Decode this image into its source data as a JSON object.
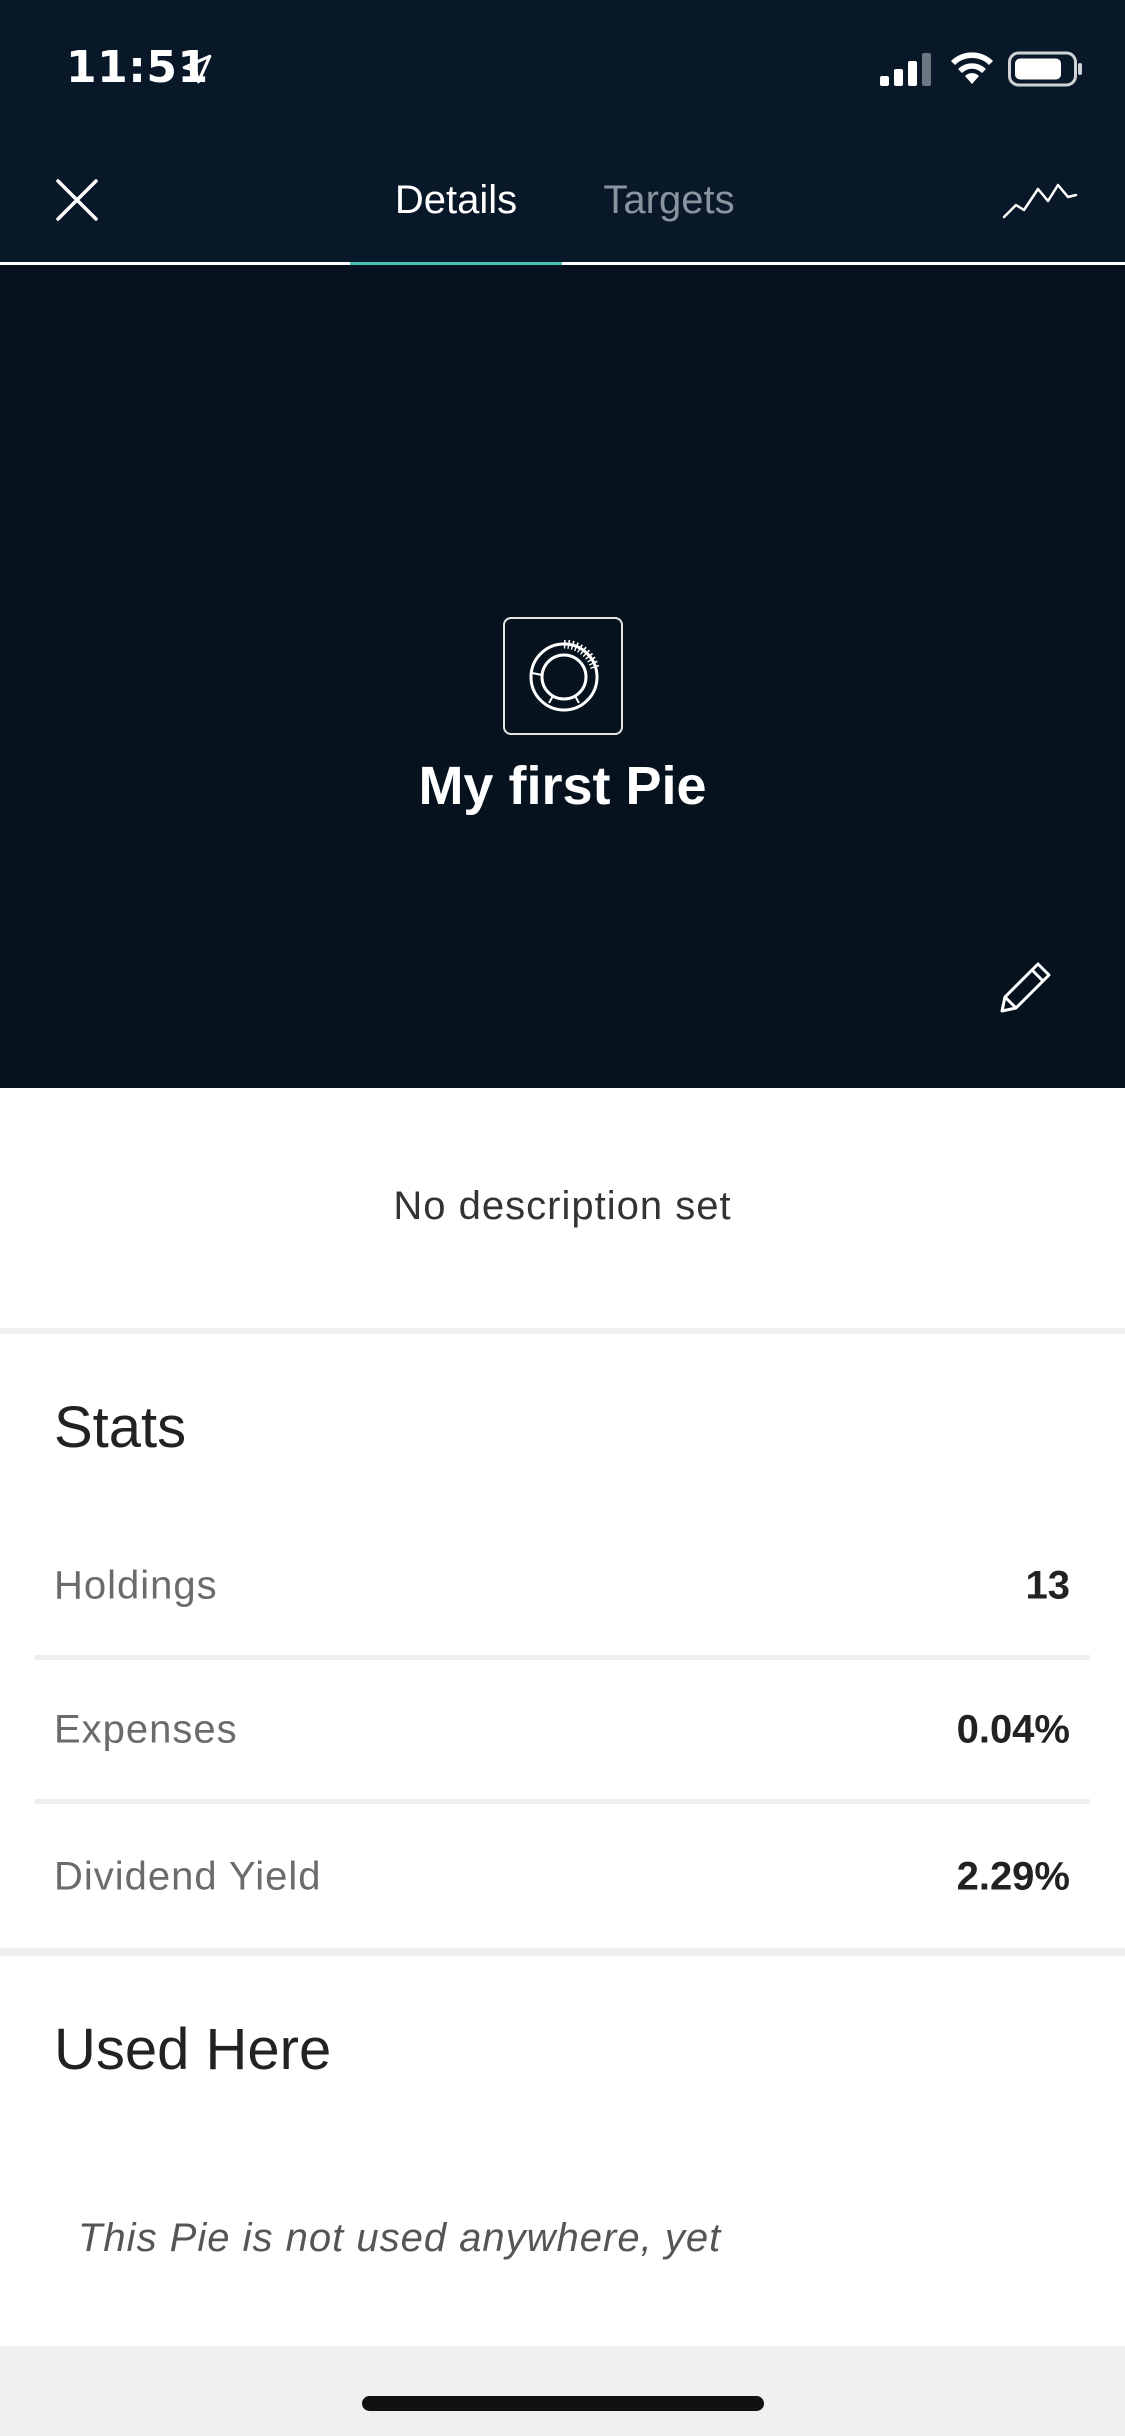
{
  "status_bar": {
    "time": "11:51"
  },
  "nav": {
    "tabs": [
      {
        "label": "Details",
        "active": true
      },
      {
        "label": "Targets",
        "active": false
      }
    ]
  },
  "hero": {
    "title": "My first Pie"
  },
  "description": {
    "text": "No description set"
  },
  "stats": {
    "title": "Stats",
    "rows": [
      {
        "label": "Holdings",
        "value": "13"
      },
      {
        "label": "Expenses",
        "value": "0.04%"
      },
      {
        "label": "Dividend Yield",
        "value": "2.29%"
      }
    ]
  },
  "used_here": {
    "title": "Used Here",
    "empty_text": "This Pie is not used anywhere, yet"
  },
  "colors": {
    "header_bg": "#081828",
    "hero_bg": "#06131f",
    "accent": "#46c2b4"
  }
}
